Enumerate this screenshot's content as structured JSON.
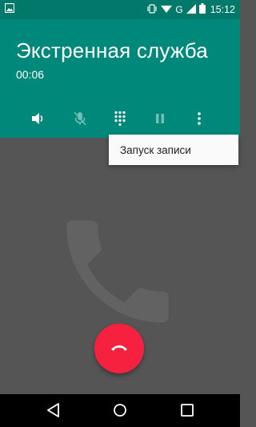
{
  "status_bar": {
    "time": "15:12",
    "network_label": "G",
    "icons": [
      "image-notification-icon",
      "vibrate-icon",
      "wifi-icon",
      "signal-icon",
      "battery-icon"
    ]
  },
  "call": {
    "title": "Экстренная служба",
    "timer": "00:06"
  },
  "controls": [
    "speaker-icon",
    "mute-icon",
    "dialpad-icon",
    "hold-icon",
    "overflow-menu-icon"
  ],
  "menu": {
    "items": [
      {
        "label": "Запуск записи"
      }
    ]
  },
  "nav": [
    "back-icon",
    "home-icon",
    "recents-icon"
  ],
  "colors": {
    "header": "#00897b",
    "status_bar": "#00796b",
    "background": "#555555",
    "end_call": "#f5213f"
  }
}
